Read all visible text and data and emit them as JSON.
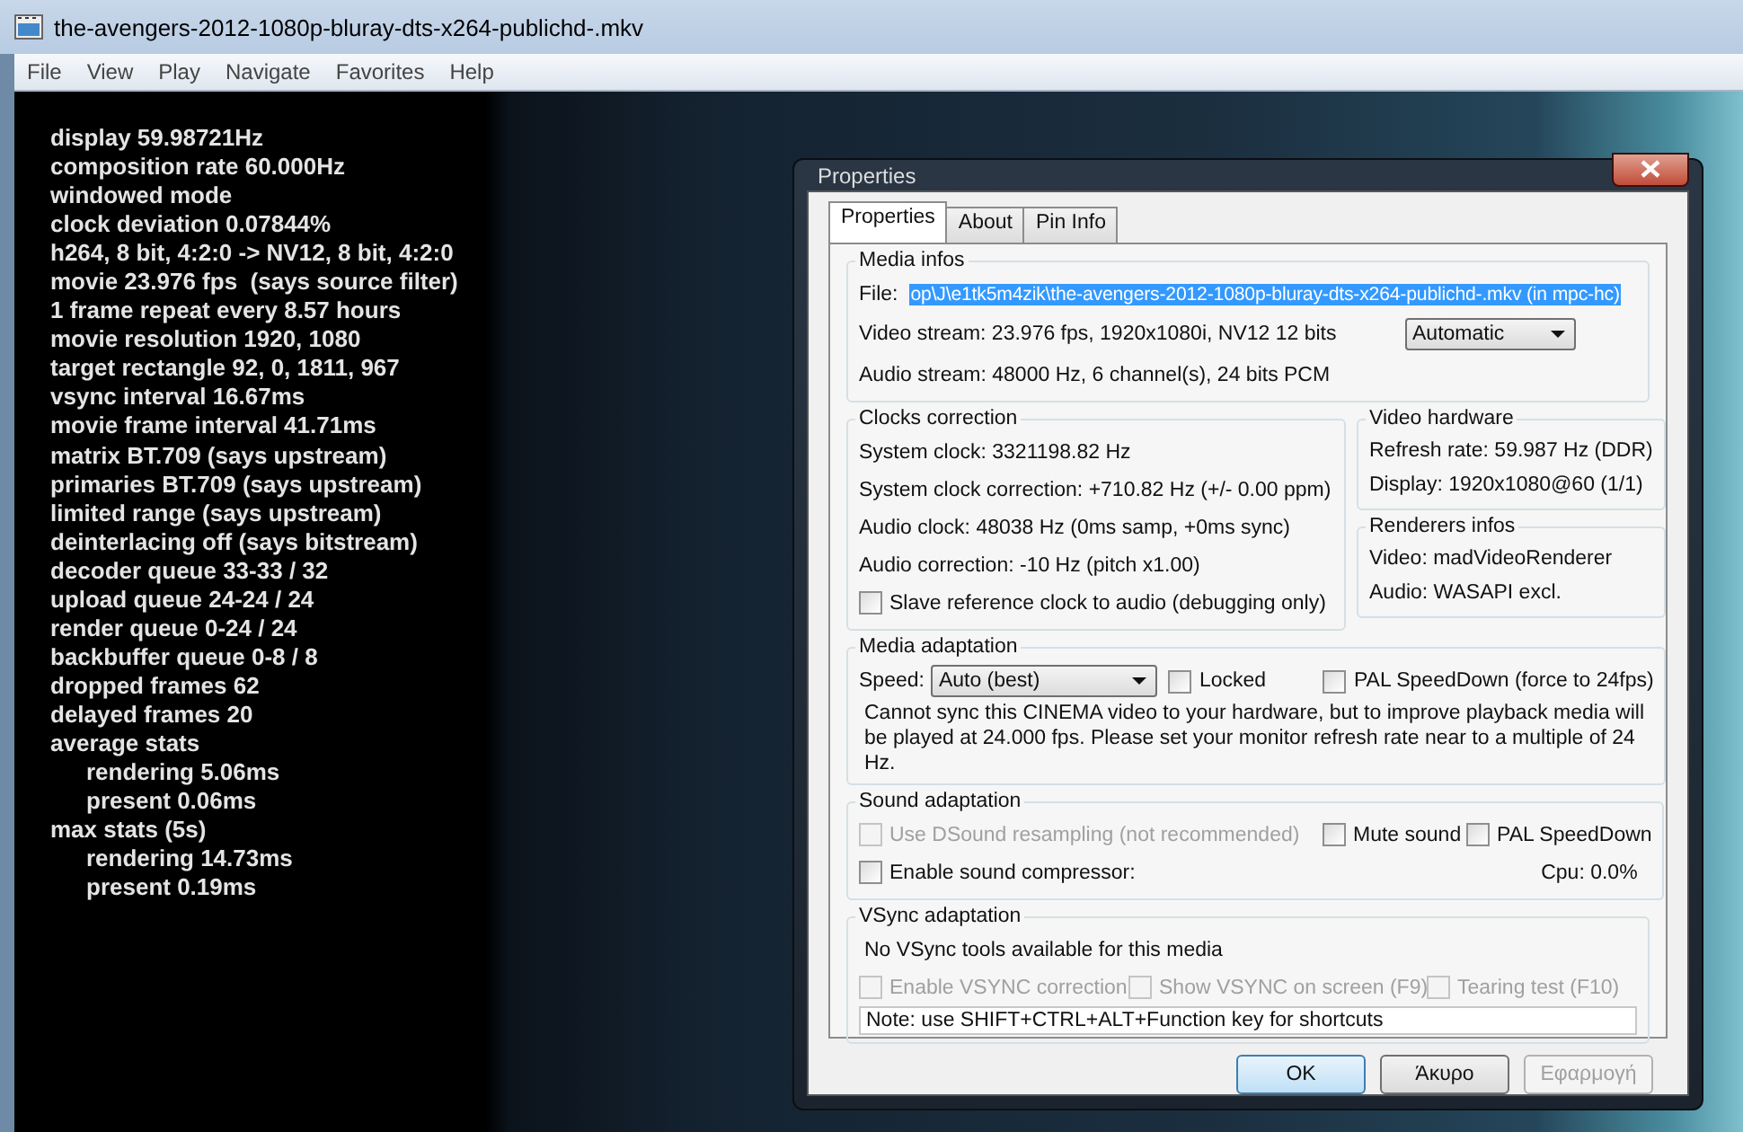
{
  "window": {
    "title": "the-avengers-2012-1080p-bluray-dts-x264-publichd-.mkv"
  },
  "menu": [
    "File",
    "View",
    "Play",
    "Navigate",
    "Favorites",
    "Help"
  ],
  "osd": [
    {
      "text": "display 59.98721Hz"
    },
    {
      "text": "composition rate 60.000Hz"
    },
    {
      "text": "windowed mode"
    },
    {
      "text": "clock deviation 0.07844%"
    },
    {
      "text": "h264, 8 bit, 4:2:0 -> NV12, 8 bit, 4:2:0"
    },
    {
      "text": "movie 23.976 fps  (says source filter)"
    },
    {
      "text": "1 frame repeat every 8.57 hours"
    },
    {
      "text": "movie resolution 1920, 1080"
    },
    {
      "text": "target rectangle 92, 0, 1811, 967"
    },
    {
      "text": "vsync interval 16.67ms"
    },
    {
      "text": "movie frame interval 41.71ms"
    },
    {
      "text": "matrix BT.709 (says upstream)"
    },
    {
      "text": "primaries BT.709 (says upstream)"
    },
    {
      "text": "limited range (says upstream)"
    },
    {
      "text": "deinterlacing off (says bitstream)"
    },
    {
      "text": "decoder queue 33-33 / 32"
    },
    {
      "text": "upload queue 24-24 / 24"
    },
    {
      "text": "render queue 0-24 / 24"
    },
    {
      "text": "backbuffer queue 0-8 / 8"
    },
    {
      "text": "dropped frames 62"
    },
    {
      "text": "delayed frames 20"
    },
    {
      "text": "average stats",
      "children": [
        {
          "text": "rendering 5.06ms"
        },
        {
          "text": "present 0.06ms"
        }
      ]
    },
    {
      "text": "max stats (5s)",
      "children": [
        {
          "text": "rendering 14.73ms"
        },
        {
          "text": "present 0.19ms"
        }
      ]
    }
  ],
  "dialog": {
    "title": "Properties",
    "tabs": [
      {
        "label": "Properties",
        "selected": true
      },
      {
        "label": "About",
        "selected": false
      },
      {
        "label": "Pin Info",
        "selected": false
      }
    ],
    "media_infos": {
      "title": "Media infos",
      "file_label": "File:",
      "file": {
        "value": "op\\J\\e1tk5m4zik\\the-avengers-2012-1080p-bluray-dts-x264-publichd-.mkv (in mpc-hc)",
        "selected": true
      },
      "video_stream": "Video stream:  23.976 fps, 1920x1080i, NV12 12 bits",
      "audio_stream": "Audio stream:  48000 Hz, 6 channel(s), 24 bits PCM",
      "mode": "Automatic"
    },
    "clocks_correction": {
      "title": "Clocks correction",
      "lines": [
        "System clock:  3321198.82 Hz",
        "System clock correction:  +710.82 Hz (+/- 0.00 ppm)",
        "Audio clock:  48038 Hz (0ms samp, +0ms sync)",
        "Audio correction:  -10 Hz (pitch x1.00)"
      ],
      "checkbox": {
        "label": "Slave reference clock to audio (debugging only)",
        "checked": false,
        "disabled": false
      }
    },
    "video_hardware": {
      "title": "Video hardware",
      "lines": [
        "Refresh rate:  59.987 Hz (DDR)",
        "Display:  1920x1080@60 (1/1)"
      ]
    },
    "renderers_infos": {
      "title": "Renderers infos",
      "lines": [
        "Video: madVideoRenderer",
        "Audio: WASAPI excl."
      ]
    },
    "media_adaptation": {
      "title": "Media adaptation",
      "speed_label": "Speed:",
      "speed": "Auto (best)",
      "checkboxes": [
        {
          "label": "Locked",
          "checked": false,
          "disabled": false
        },
        {
          "label": "PAL SpeedDown (force to 24fps)",
          "checked": false,
          "disabled": false
        }
      ],
      "message": "Cannot sync this CINEMA video to your hardware, but to improve playback media will be played at 24.000 fps. Please set your monitor refresh rate near to a multiple of 24 Hz."
    },
    "sound_adaptation": {
      "title": "Sound adaptation",
      "checkboxes": [
        {
          "label": "Use DSound resampling (not recommended)",
          "checked": false,
          "disabled": true
        },
        {
          "label": "Mute sound",
          "checked": false,
          "disabled": false
        },
        {
          "label": "PAL SpeedDown",
          "checked": false,
          "disabled": false
        },
        {
          "label": "Enable sound compressor:",
          "checked": false,
          "disabled": false
        }
      ],
      "cpu": "Cpu: 0.0%"
    },
    "vsync_adaptation": {
      "title": "VSync adaptation",
      "message": "No VSync tools available for this media",
      "checkboxes": [
        {
          "label": "Enable VSYNC correction",
          "checked": false,
          "disabled": true
        },
        {
          "label": "Show VSYNC on screen (F9)",
          "checked": false,
          "disabled": true
        },
        {
          "label": "Tearing test (F10)",
          "checked": false,
          "disabled": true
        }
      ],
      "note": "Note: use SHIFT+CTRL+ALT+Function key for shortcuts"
    },
    "buttons": [
      {
        "label": "OK",
        "kind": "default"
      },
      {
        "label": "Άκυρο",
        "kind": "normal"
      },
      {
        "label": "Εφαρμογή",
        "kind": "disabled"
      }
    ]
  }
}
